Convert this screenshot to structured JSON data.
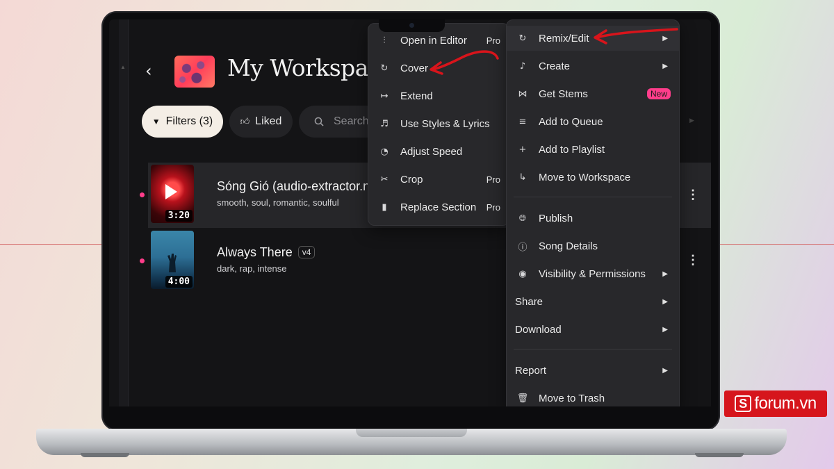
{
  "workspace": {
    "back_icon": "chevron-left-icon",
    "title": "My Workspace"
  },
  "toolbar": {
    "filters_label": "Filters (3)",
    "liked_label": "Liked",
    "search_placeholder": "Search"
  },
  "songs": [
    {
      "title": "Sóng Gió (audio-extractor.net",
      "tags": "smooth, soul, romantic, soulful",
      "duration": "3:20",
      "version": ""
    },
    {
      "title": "Always There",
      "tags": "dark, rap, intense",
      "duration": "4:00",
      "version": "v4"
    }
  ],
  "remix_submenu": [
    {
      "label": "Open in Editor",
      "icon": "sliders-icon",
      "tag": "Pro"
    },
    {
      "label": "Cover",
      "icon": "cycle-icon",
      "tag": ""
    },
    {
      "label": "Extend",
      "icon": "extend-arrow-icon",
      "tag": ""
    },
    {
      "label": "Use Styles & Lyrics",
      "icon": "music-shuffle-icon",
      "tag": ""
    },
    {
      "label": "Adjust Speed",
      "icon": "speed-gauge-icon",
      "tag": ""
    },
    {
      "label": "Crop",
      "icon": "scissors-icon",
      "tag": "Pro"
    },
    {
      "label": "Replace Section",
      "icon": "replace-section-icon",
      "tag": "Pro"
    }
  ],
  "context_menu": {
    "items_group1": [
      {
        "label": "Remix/Edit",
        "icon": "cycle-icon",
        "tag": ""
      },
      {
        "label": "Create",
        "icon": "music-note-icon",
        "tag": ""
      },
      {
        "label": "Get Stems",
        "icon": "stems-icon",
        "tag": "New"
      },
      {
        "label": "Add to Queue",
        "icon": "queue-icon",
        "tag": ""
      },
      {
        "label": "Add to Playlist",
        "icon": "plus-icon",
        "tag": ""
      },
      {
        "label": "Move to Workspace",
        "icon": "move-arrow-icon",
        "tag": ""
      }
    ],
    "items_group2": [
      {
        "label": "Publish",
        "icon": "globe-icon"
      },
      {
        "label": "Song Details",
        "icon": "info-icon"
      },
      {
        "label": "Visibility & Permissions",
        "icon": "eye-icon"
      },
      {
        "label": "Share",
        "icon": ""
      },
      {
        "label": "Download",
        "icon": ""
      }
    ],
    "items_group3": [
      {
        "label": "Report",
        "icon": ""
      },
      {
        "label": "Move to Trash",
        "icon": "trash-icon"
      }
    ]
  },
  "branding": {
    "logo_letter": "S",
    "logo_text": "forum.vn",
    "logo_color": "#d6151c"
  },
  "colors": {
    "accent_pink": "#ff3d8b",
    "annotation_red": "#d8141b"
  }
}
